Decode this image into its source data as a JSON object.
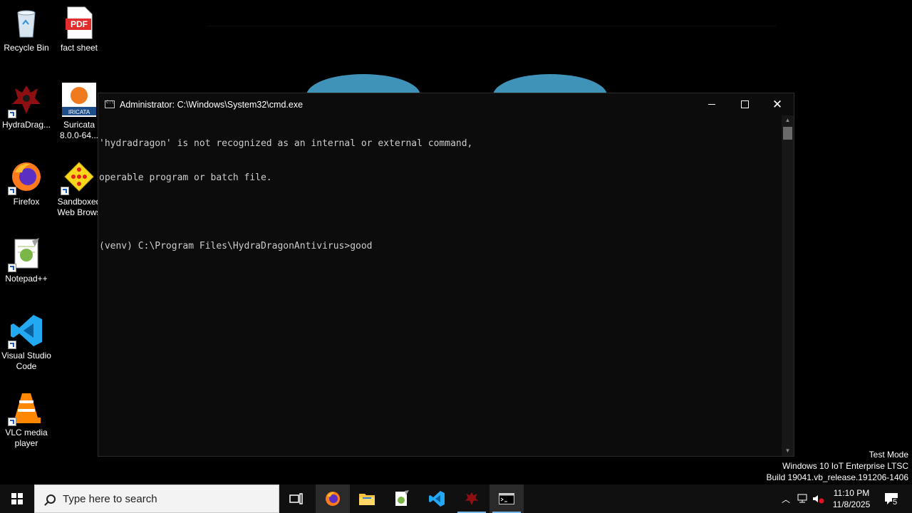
{
  "desktop": {
    "icons": [
      {
        "label": "Recycle Bin"
      },
      {
        "label": "fact sheet",
        "badge": "PDF"
      },
      {
        "label": "HydraDrag..."
      },
      {
        "label": "Suricata 8.0.0-64...",
        "badge": "IRICATA"
      },
      {
        "label": "Firefox"
      },
      {
        "label": "Sandboxed Web Brows"
      },
      {
        "label": "Notepad++"
      },
      {
        "label": "Visual Studio Code"
      },
      {
        "label": "VLC media player"
      }
    ]
  },
  "cmd": {
    "title": "Administrator: C:\\Windows\\System32\\cmd.exe",
    "lines": [
      "'hydradragon' is not recognized as an internal or external command,",
      "operable program or batch file.",
      "",
      "(venv) C:\\Program Files\\HydraDragonAntivirus>good"
    ]
  },
  "watermark": {
    "line1": "Test Mode",
    "line2": "Windows 10 IoT Enterprise LTSC",
    "line3": "Build 19041.vb_release.191206-1406"
  },
  "taskbar": {
    "search_placeholder": "Type here to search",
    "apps": [
      "task-view",
      "firefox",
      "file-explorer",
      "notepad-plus-plus",
      "vs-code",
      "hydradragon",
      "cmd"
    ],
    "clock_time": "11:10 PM",
    "clock_date": "11/8/2025",
    "notification_count": "5"
  },
  "colors": {
    "console_bg": "#0c0c0c",
    "console_text": "#cccccc",
    "taskbar_bg": "#101010",
    "accent": "#76b9ed"
  }
}
